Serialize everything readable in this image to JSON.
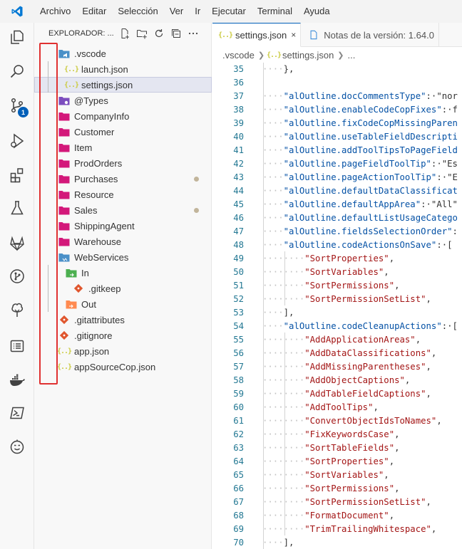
{
  "menubar": {
    "items": [
      "Archivo",
      "Editar",
      "Selección",
      "Ver",
      "Ir",
      "Ejecutar",
      "Terminal",
      "Ayuda"
    ]
  },
  "activity_bar": {
    "items": [
      {
        "icon": "explorer-icon"
      },
      {
        "icon": "search-icon"
      },
      {
        "icon": "source-control-icon",
        "badge": "1"
      },
      {
        "icon": "run-debug-icon"
      },
      {
        "icon": "extensions-icon"
      },
      {
        "icon": "testing-icon"
      },
      {
        "icon": "gitlab-icon"
      },
      {
        "icon": "git-graph-icon"
      },
      {
        "icon": "tree-icon"
      },
      {
        "icon": "list-icon"
      },
      {
        "icon": "docker-icon"
      },
      {
        "icon": "powershell-icon"
      },
      {
        "icon": "smiley-icon"
      }
    ]
  },
  "sidebar": {
    "title": "EXPLORADOR: ...",
    "actions": [
      "new-file-icon",
      "new-folder-icon",
      "refresh-icon",
      "collapse-icon",
      "more-icon"
    ],
    "tree": [
      {
        "label": ".vscode",
        "kind": "folder-vscode",
        "depth": 0
      },
      {
        "label": "launch.json",
        "kind": "json",
        "depth": 1
      },
      {
        "label": "settings.json",
        "kind": "json",
        "depth": 1,
        "selected": true
      },
      {
        "label": "@Types",
        "kind": "folder-purple",
        "depth": 0
      },
      {
        "label": "CompanyInfo",
        "kind": "folder-pink",
        "depth": 0
      },
      {
        "label": "Customer",
        "kind": "folder-pink",
        "depth": 0
      },
      {
        "label": "Item",
        "kind": "folder-pink",
        "depth": 0
      },
      {
        "label": "ProdOrders",
        "kind": "folder-pink",
        "depth": 0
      },
      {
        "label": "Purchases",
        "kind": "folder-pink",
        "depth": 0,
        "dot": true
      },
      {
        "label": "Resource",
        "kind": "folder-pink",
        "depth": 0
      },
      {
        "label": "Sales",
        "kind": "folder-pink",
        "depth": 0,
        "dot": true
      },
      {
        "label": "ShippingAgent",
        "kind": "folder-pink",
        "depth": 0
      },
      {
        "label": "Warehouse",
        "kind": "folder-pink",
        "depth": 0
      },
      {
        "label": "WebServices",
        "kind": "folder-blue",
        "depth": 0
      },
      {
        "label": "In",
        "kind": "folder-green",
        "depth": 1
      },
      {
        "label": ".gitkeep",
        "kind": "git",
        "depth": 2
      },
      {
        "label": "Out",
        "kind": "folder-orange",
        "depth": 1
      },
      {
        "label": ".gitattributes",
        "kind": "git",
        "depth": 0
      },
      {
        "label": ".gitignore",
        "kind": "git",
        "depth": 0
      },
      {
        "label": "app.json",
        "kind": "json",
        "depth": 0
      },
      {
        "label": "appSourceCop.json",
        "kind": "json",
        "depth": 0
      }
    ]
  },
  "tabs": [
    {
      "label": "settings.json",
      "active": true,
      "close": "×"
    },
    {
      "label": "Notas de la versión: 1.64.0",
      "active": false
    }
  ],
  "breadcrumb": [
    ".vscode",
    "settings.json",
    "..."
  ],
  "editor": {
    "lines": [
      {
        "n": "35",
        "ind": 1,
        "text": "},",
        "t": "pun"
      },
      {
        "n": "36",
        "ind": 0,
        "text": "",
        "t": "pun"
      },
      {
        "n": "37",
        "ind": 1,
        "key": "\"alOutline.docCommentsType\"",
        "rest": ":·\"nor"
      },
      {
        "n": "38",
        "ind": 1,
        "key": "\"alOutline.enableCodeCopFixes\"",
        "rest": ":·f"
      },
      {
        "n": "39",
        "ind": 1,
        "key": "\"alOutline.fixCodeCopMissingParen",
        "rest": ""
      },
      {
        "n": "40",
        "ind": 1,
        "key": "\"alOutline.useTableFieldDescripti",
        "rest": ""
      },
      {
        "n": "41",
        "ind": 1,
        "key": "\"alOutline.addToolTipsToPageField",
        "rest": ""
      },
      {
        "n": "42",
        "ind": 1,
        "key": "\"alOutline.pageFieldToolTip\"",
        "rest": ":·\"Es"
      },
      {
        "n": "43",
        "ind": 1,
        "key": "\"alOutline.pageActionToolTip\"",
        "rest": ":·\"E"
      },
      {
        "n": "44",
        "ind": 1,
        "key": "\"alOutline.defaultDataClassificat",
        "rest": ""
      },
      {
        "n": "45",
        "ind": 1,
        "key": "\"alOutline.defaultAppArea\"",
        "rest": ":·\"All\""
      },
      {
        "n": "46",
        "ind": 1,
        "key": "\"alOutline.defaultListUsageCatego",
        "rest": ""
      },
      {
        "n": "47",
        "ind": 1,
        "key": "\"alOutline.fieldsSelectionOrder\"",
        "rest": ":"
      },
      {
        "n": "48",
        "ind": 1,
        "key": "\"alOutline.codeActionsOnSave\"",
        "rest": ":·["
      },
      {
        "n": "49",
        "ind": 2,
        "str": "\"SortProperties\"",
        "rest": ","
      },
      {
        "n": "50",
        "ind": 2,
        "str": "\"SortVariables\"",
        "rest": ","
      },
      {
        "n": "51",
        "ind": 2,
        "str": "\"SortPermissions\"",
        "rest": ","
      },
      {
        "n": "52",
        "ind": 2,
        "str": "\"SortPermissionSetList\"",
        "rest": ","
      },
      {
        "n": "53",
        "ind": 1,
        "text": "],",
        "t": "pun"
      },
      {
        "n": "54",
        "ind": 1,
        "key": "\"alOutline.codeCleanupActions\"",
        "rest": ":·["
      },
      {
        "n": "55",
        "ind": 2,
        "str": "\"AddApplicationAreas\"",
        "rest": ","
      },
      {
        "n": "56",
        "ind": 2,
        "str": "\"AddDataClassifications\"",
        "rest": ","
      },
      {
        "n": "57",
        "ind": 2,
        "str": "\"AddMissingParentheses\"",
        "rest": ","
      },
      {
        "n": "58",
        "ind": 2,
        "str": "\"AddObjectCaptions\"",
        "rest": ","
      },
      {
        "n": "59",
        "ind": 2,
        "str": "\"AddTableFieldCaptions\"",
        "rest": ","
      },
      {
        "n": "60",
        "ind": 2,
        "str": "\"AddToolTips\"",
        "rest": ","
      },
      {
        "n": "61",
        "ind": 2,
        "str": "\"ConvertObjectIdsToNames\"",
        "rest": ","
      },
      {
        "n": "62",
        "ind": 2,
        "str": "\"FixKeywordsCase\"",
        "rest": ","
      },
      {
        "n": "63",
        "ind": 2,
        "str": "\"SortTableFields\"",
        "rest": ","
      },
      {
        "n": "64",
        "ind": 2,
        "str": "\"SortProperties\"",
        "rest": ","
      },
      {
        "n": "65",
        "ind": 2,
        "str": "\"SortVariables\"",
        "rest": ","
      },
      {
        "n": "66",
        "ind": 2,
        "str": "\"SortPermissions\"",
        "rest": ","
      },
      {
        "n": "67",
        "ind": 2,
        "str": "\"SortPermissionSetList\"",
        "rest": ","
      },
      {
        "n": "68",
        "ind": 2,
        "str": "\"FormatDocument\"",
        "rest": ","
      },
      {
        "n": "69",
        "ind": 2,
        "str": "\"TrimTrailingWhitespace\"",
        "rest": ","
      },
      {
        "n": "70",
        "ind": 1,
        "text": "],",
        "t": "pun"
      }
    ]
  },
  "colors": {
    "accent": "#005fb8",
    "highlight_box": "#e03131",
    "folder_pink": "#d3187a",
    "folder_purple": "#7c4dbe",
    "folder_blue": "#4a90c8",
    "folder_green": "#4caf50",
    "folder_orange": "#ff8a50",
    "git_orange": "#e0562e"
  }
}
